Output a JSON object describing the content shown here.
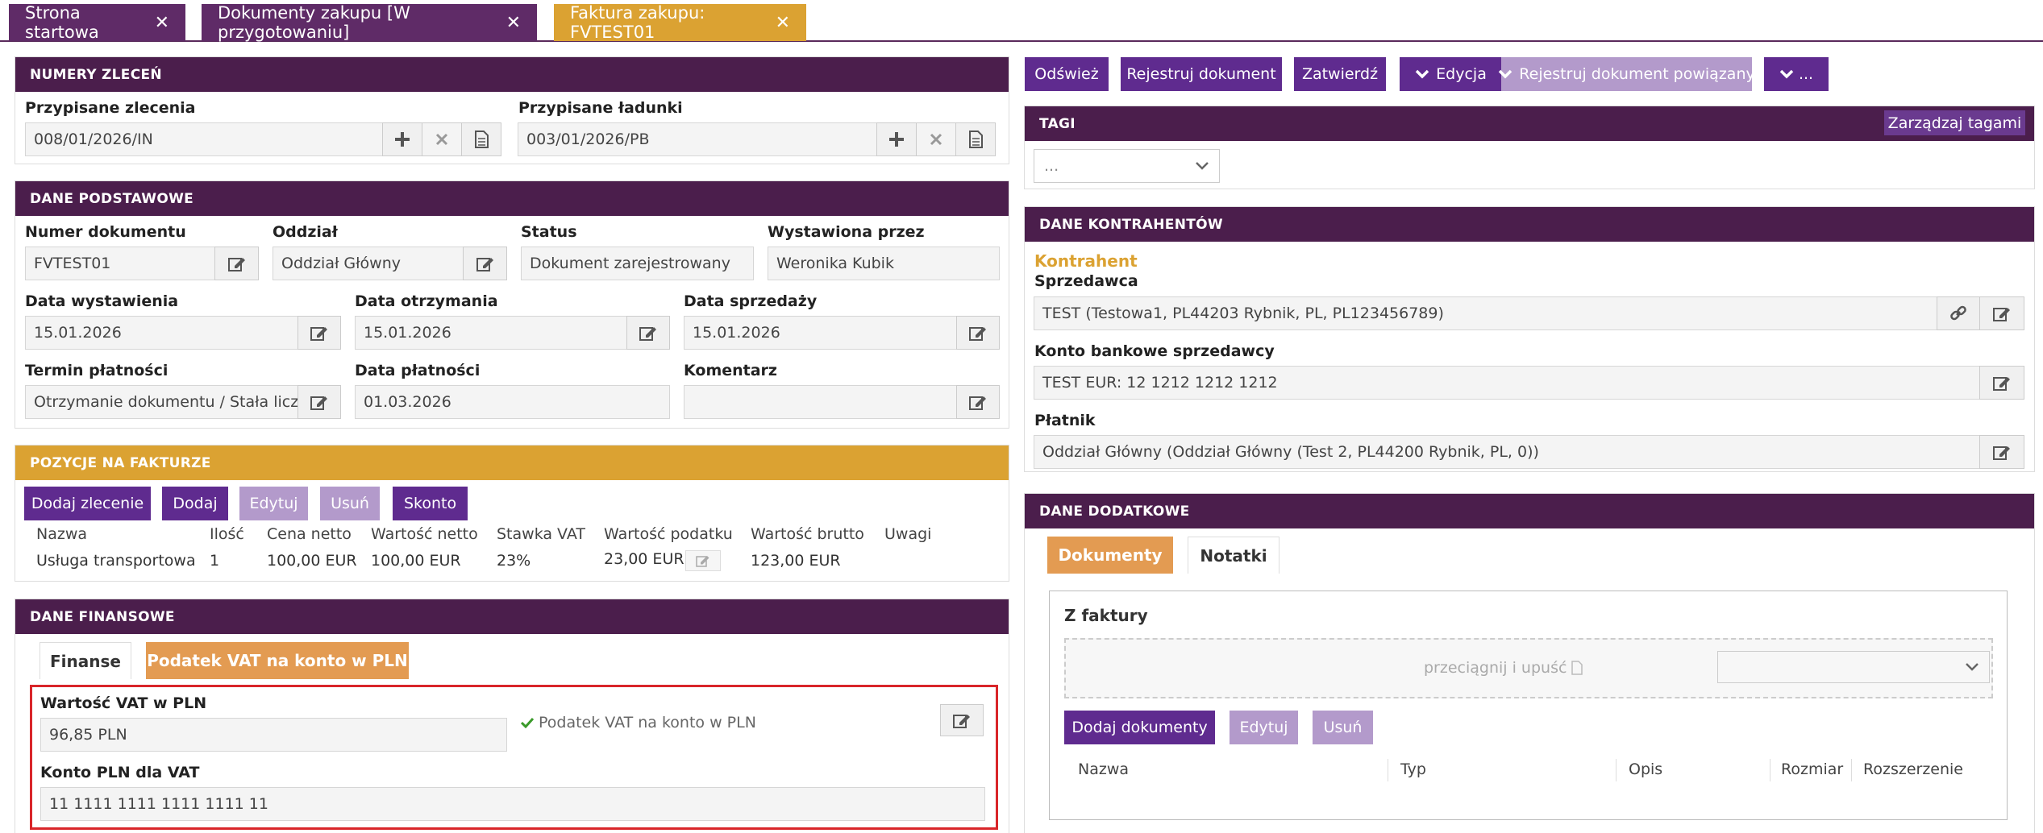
{
  "tabs": [
    "Strona startowa",
    "Dokumenty zakupu [W przygotowaniu]",
    "Faktura zakupu: FVTEST01"
  ],
  "numery": {
    "title": "NUMERY ZLECEŃ",
    "zlecenia_label": "Przypisane zlecenia",
    "zlecenia_value": "008/01/2026/IN",
    "ladunki_label": "Przypisane ładunki",
    "ladunki_value": "003/01/2026/PB"
  },
  "podst": {
    "title": "DANE PODSTAWOWE",
    "nr_label": "Numer dokumentu",
    "nr_value": "FVTEST01",
    "oddzial_label": "Oddział",
    "oddzial_value": "Oddział Główny",
    "status_label": "Status",
    "status_value": "Dokument zarejestrowany",
    "wyst_label": "Wystawiona przez",
    "wyst_value": "Weronika Kubik",
    "dw_label": "Data wystawienia",
    "dw_value": "15.01.2026",
    "do_label": "Data otrzymania",
    "do_value": "15.01.2026",
    "ds_label": "Data sprzedaży",
    "ds_value": "15.01.2026",
    "tp_label": "Termin płatności",
    "tp_value": "Otrzymanie dokumentu / Stała liczba",
    "dp_label": "Data płatności",
    "dp_value": "01.03.2026",
    "kom_label": "Komentarz",
    "kom_value": ""
  },
  "poz": {
    "title": "POZYCJE NA FAKTURZE",
    "buttons": [
      "Dodaj zlecenie",
      "Dodaj",
      "Edytuj",
      "Usuń",
      "Skonto"
    ],
    "headers": [
      "Nazwa",
      "Ilość",
      "Cena netto",
      "Wartość netto",
      "Stawka VAT",
      "Wartość podatku",
      "Wartość brutto",
      "Uwagi"
    ],
    "row": [
      "Usługa transportowa",
      "1",
      "100,00 EUR",
      "100,00 EUR",
      "23%",
      "23,00 EUR",
      "123,00 EUR",
      ""
    ]
  },
  "fin": {
    "title": "DANE FINANSOWE",
    "tab1": "Finanse",
    "tab2": "Podatek VAT na konto w PLN",
    "vat_label": "Wartość VAT w PLN",
    "vat_value": "96,85 PLN",
    "check_text": "Podatek VAT na konto w PLN",
    "konto_label": "Konto PLN dla VAT",
    "konto_value": "11 1111 1111 1111 1111 11"
  },
  "toolbar": {
    "odswiez": "Odśwież",
    "rejestruj": "Rejestruj dokument",
    "zatwierdz": "Zatwierdź",
    "edycja": "Edycja",
    "powiazany": "Rejestruj dokument powiązany",
    "more": "..."
  },
  "tagi": {
    "title": "TAGI",
    "manage": "Zarządzaj tagami",
    "select": "..."
  },
  "kontr": {
    "title": "DANE KONTRAHENTÓW",
    "section": "Kontrahent",
    "sprz_label": "Sprzedawca",
    "sprz_value": "TEST (Testowa1, PL44203 Rybnik, PL, PL123456789)",
    "konto_label": "Konto bankowe sprzedawcy",
    "konto_value": "TEST EUR: 12 1212 1212 1212",
    "plat_label": "Płatnik",
    "plat_value": "Oddział Główny  (Oddział Główny  (Test 2, PL44200 Rybnik, PL, 0))"
  },
  "dod": {
    "title": "DANE DODATKOWE",
    "tab1": "Dokumenty",
    "tab2": "Notatki",
    "section": "Z faktury",
    "drop": "przeciągnij i upuść",
    "buttons": [
      "Dodaj dokumenty",
      "Edytuj",
      "Usuń"
    ],
    "headers": [
      "Nazwa",
      "Typ",
      "Opis",
      "Rozmiar",
      "Rozszerzenie"
    ]
  },
  "colors": {
    "header": "#4b1e4c",
    "gold": "#dba232",
    "button": "#5f2b8f",
    "disabled": "#b39acb",
    "orange": "#e39b52",
    "highlight": "#d9262a"
  }
}
